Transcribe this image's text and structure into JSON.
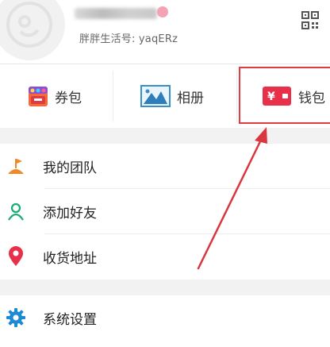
{
  "header": {
    "user_id_text": "胖胖生活号: yaqERz",
    "avatar_icon": "user-avatar-icon",
    "qr_icon": "qr-code-icon"
  },
  "quickbar": {
    "items": [
      {
        "label": "券包",
        "icon": "coupon-icon"
      },
      {
        "label": "相册",
        "icon": "album-icon"
      },
      {
        "label": "钱包",
        "icon": "wallet-icon"
      }
    ]
  },
  "menu": {
    "items": [
      {
        "label": "我的团队",
        "icon": "team-flag-icon",
        "color": "#f08a24"
      },
      {
        "label": "添加好友",
        "icon": "add-friend-icon",
        "color": "#1aab73"
      },
      {
        "label": "收货地址",
        "icon": "location-pin-icon",
        "color": "#e8304a"
      },
      {
        "label": "系统设置",
        "icon": "gear-icon",
        "color": "#1e8ad6"
      }
    ]
  },
  "colors": {
    "highlight_border": "#e23a43",
    "arrow": "#d9363e",
    "wallet": "#e8304a"
  }
}
